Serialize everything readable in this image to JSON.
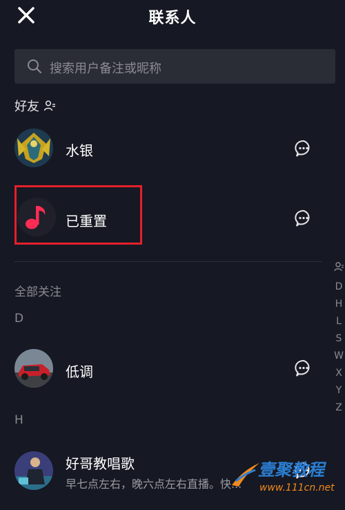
{
  "header": {
    "title": "联系人"
  },
  "search": {
    "placeholder": "搜索用户备注或昵称"
  },
  "friends": {
    "label": "好友",
    "items": [
      {
        "name": "水银"
      },
      {
        "name": "已重置"
      }
    ]
  },
  "following": {
    "label": "全部关注",
    "groups": [
      {
        "letter": "D",
        "items": [
          {
            "name": "低调"
          }
        ]
      },
      {
        "letter": "H",
        "items": [
          {
            "name": "好哥教唱歌",
            "subtitle": "早七点左右，晚六点左右直播。快..."
          }
        ]
      }
    ]
  },
  "index_bar": {
    "letters": [
      "D",
      "H",
      "L",
      "S",
      "W",
      "X",
      "Y",
      "Z"
    ]
  },
  "watermark": {
    "text": "壹聚教程",
    "url": "www.111cn.net"
  },
  "colors": {
    "background": "#161823",
    "highlight_border": "#e5202b",
    "music_icon": "#fe2c55"
  }
}
